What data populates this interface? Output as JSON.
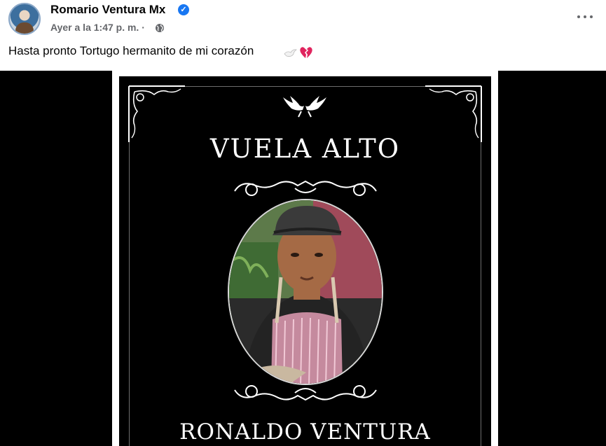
{
  "post": {
    "author": "Romario Ventura Mx",
    "timestamp": "Ayer a la 1:47 p. m. ·",
    "caption": "Hasta pronto Tortugo hermanito de mi corazón"
  },
  "image": {
    "title": "VUELA ALTO",
    "name": "RONALDO VENTURA"
  },
  "icons": {
    "verified": "verified-badge-icon",
    "audience": "globe-icon",
    "more": "more-options-icon",
    "emoji_1": "dove-icon",
    "emoji_2": "broken-heart-icon"
  },
  "colors": {
    "verified": "#1877f2",
    "meta_text": "#65676b",
    "broken_heart": "#e0245e"
  }
}
